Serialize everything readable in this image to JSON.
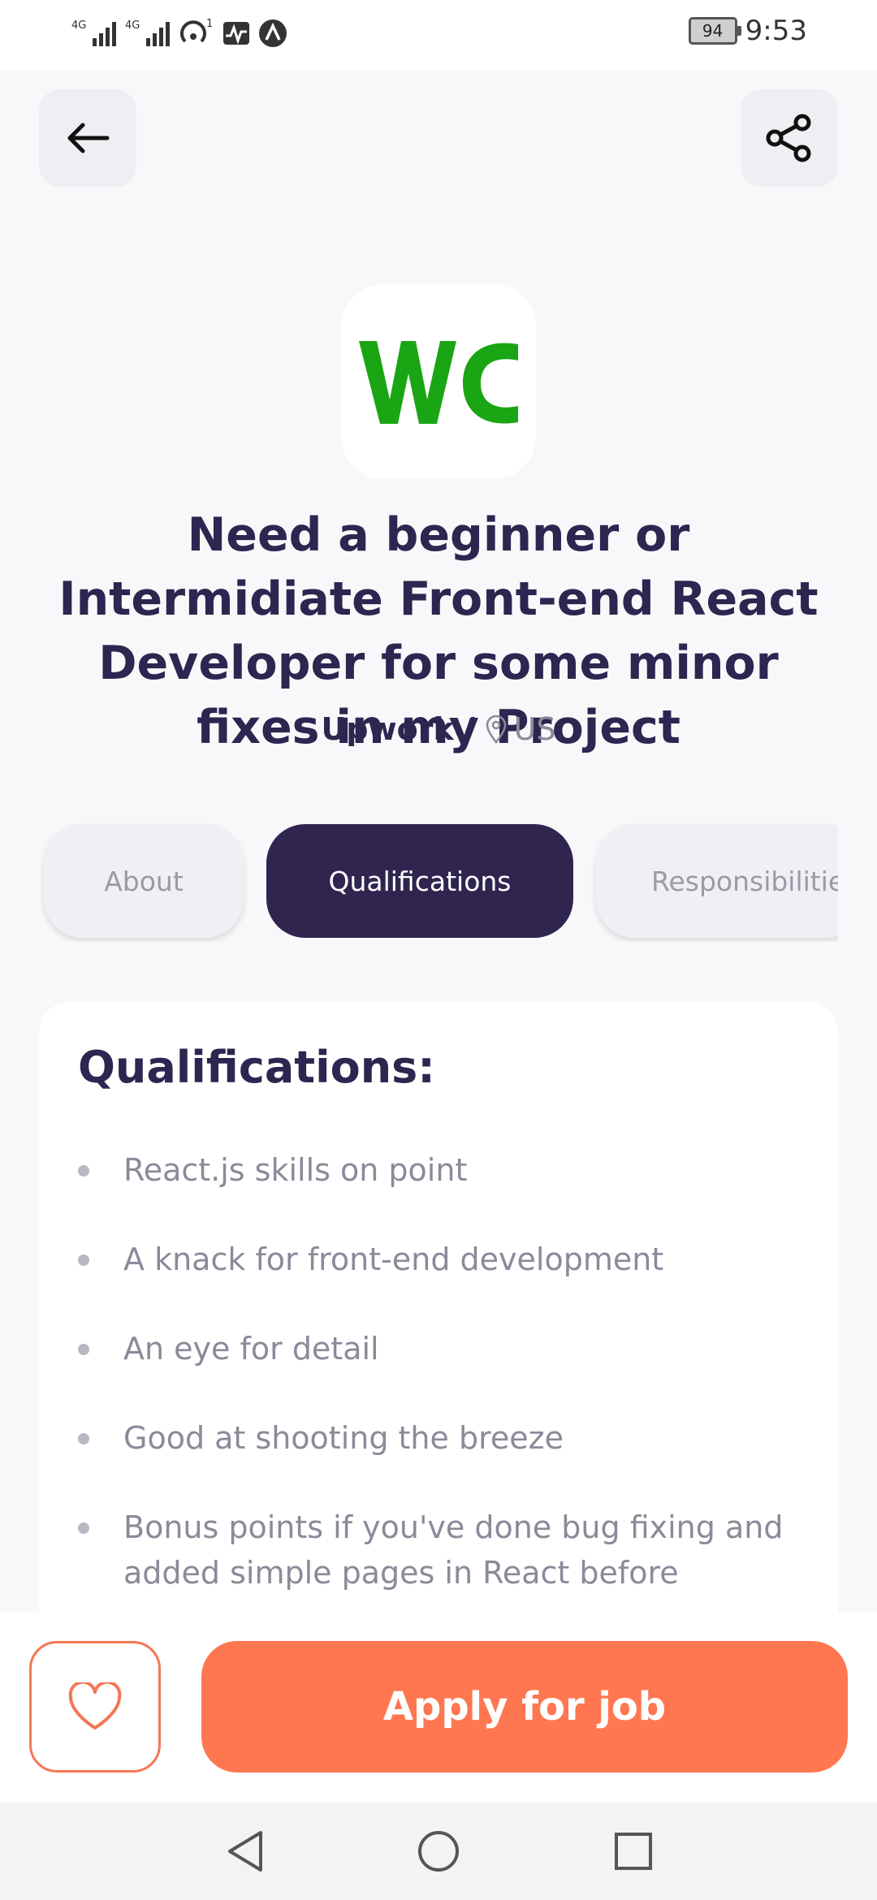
{
  "status_bar": {
    "signal_1": "4G",
    "signal_2": "4G",
    "hotspot_count": "1",
    "battery": "94",
    "time": "9:53"
  },
  "header": {
    "back_icon": "arrow-left-icon",
    "share_icon": "share-icon"
  },
  "job": {
    "logo_text": "WC",
    "logo_color": "#1aa514",
    "title": "Need a beginner or Intermidiate Front-end React Developer for some minor fixes in my Project",
    "company": "Upwork",
    "separator": "/",
    "location": "US"
  },
  "tabs": [
    {
      "label": "About",
      "active": false
    },
    {
      "label": "Qualifications",
      "active": true
    },
    {
      "label": "Responsibilities",
      "active": false
    }
  ],
  "qualifications": {
    "heading": "Qualifications:",
    "items": [
      "React.js skills on point",
      "A knack for front-end development",
      "An eye for detail",
      "Good at shooting the breeze",
      "Bonus points if you've done bug fixing and added simple pages in React before"
    ]
  },
  "footer": {
    "favorite_icon": "heart-icon",
    "apply_label": "Apply for job"
  },
  "colors": {
    "primary_dark": "#2f254f",
    "accent": "#ff7750",
    "background": "#f8f8fa"
  }
}
